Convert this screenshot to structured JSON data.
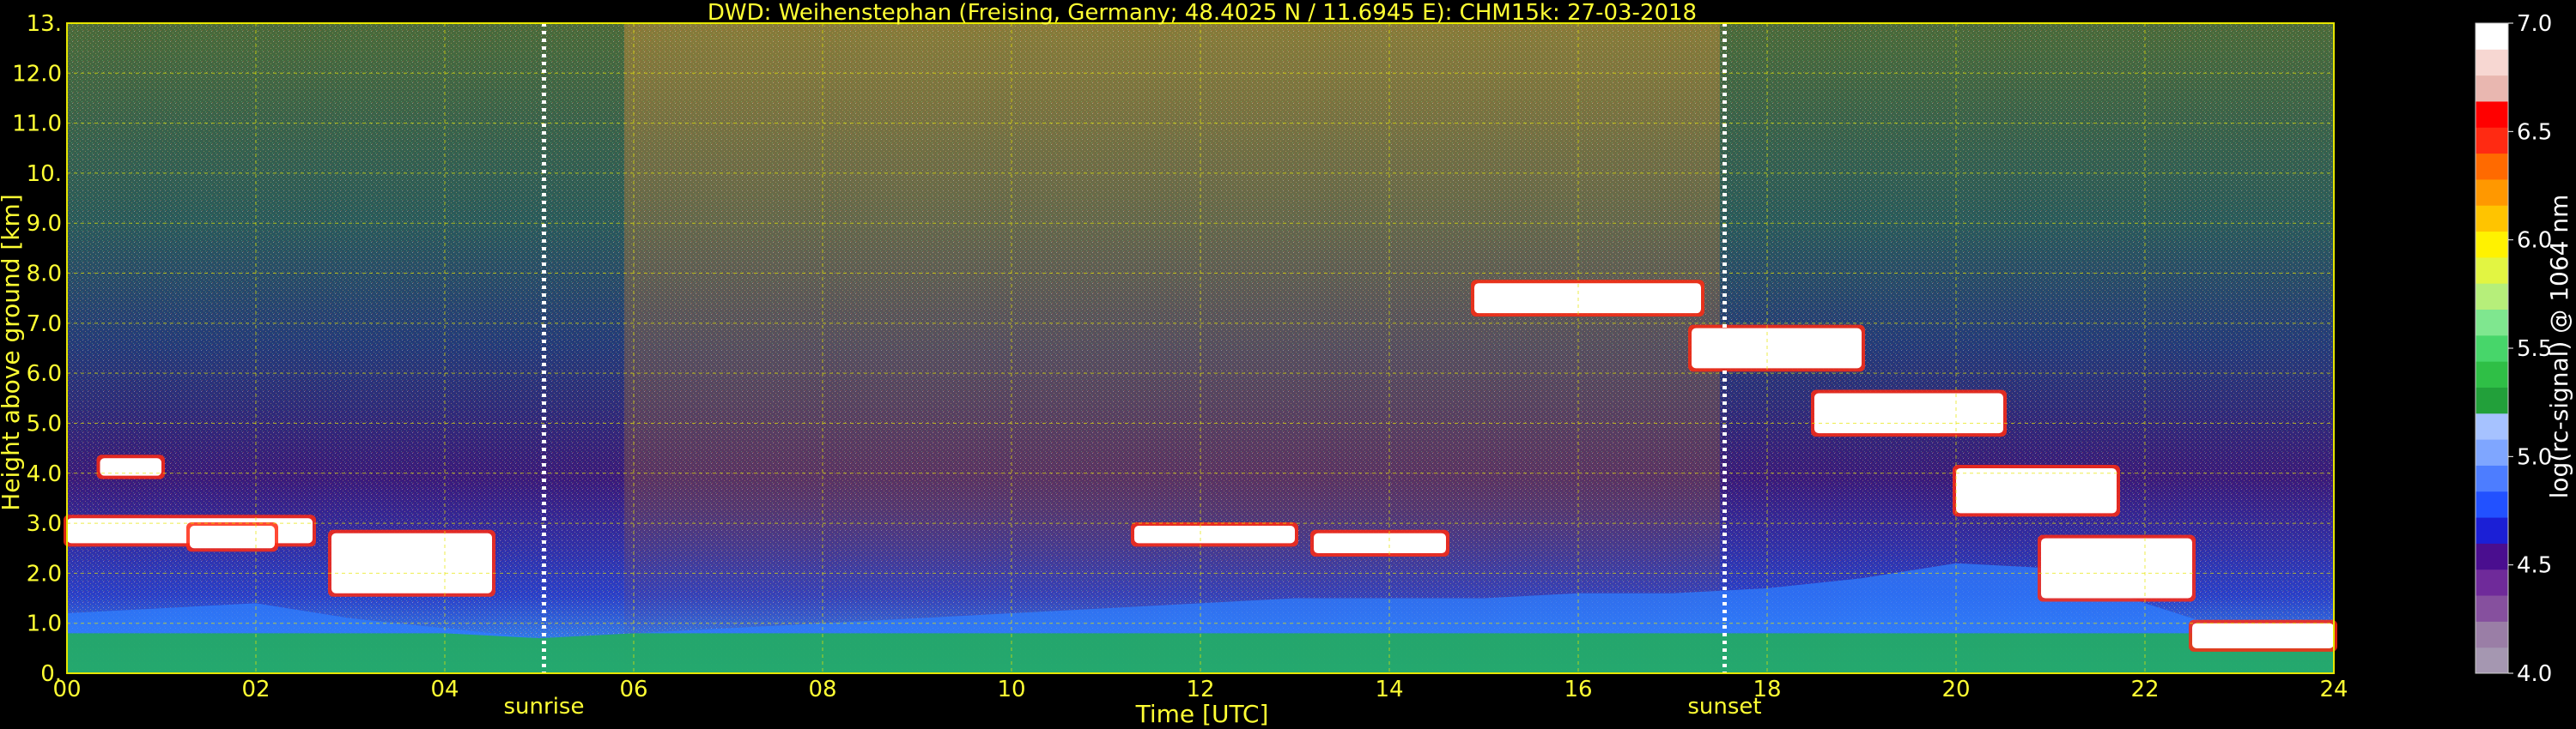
{
  "chart_data": {
    "type": "heatmap",
    "title": "DWD: Weihenstephan (Freising, Germany; 48.4025 N / 11.6945 E):    CHM15k: 27-03-2018",
    "xlabel": "Time [UTC]",
    "ylabel": "Height above ground [km]",
    "xlim": [
      0,
      24
    ],
    "ylim": [
      0,
      13
    ],
    "x_ticks": [
      "00",
      "02",
      "04",
      "06",
      "08",
      "10",
      "12",
      "14",
      "16",
      "18",
      "20",
      "22",
      "24"
    ],
    "y_ticks": [
      "0.",
      "1.0",
      "2.0",
      "3.0",
      "4.0",
      "5.0",
      "6.0",
      "7.0",
      "8.0",
      "9.0",
      "10.",
      "11.0",
      "12.0",
      "13."
    ],
    "grid": true,
    "annotations": [
      {
        "label": "sunrise",
        "x": 5.05
      },
      {
        "label": "sunset",
        "x": 17.55
      }
    ],
    "colorbar": {
      "label": "log(rc-signal) @ 1064 nm",
      "range": [
        4.0,
        7.0
      ],
      "ticks": [
        "4.0",
        "4.5",
        "5.0",
        "5.5",
        "6.0",
        "6.5",
        "7.0"
      ],
      "colors": [
        "#a597b1",
        "#9a7ea6",
        "#86509e",
        "#6f2a9a",
        "#4a0e8f",
        "#1b1fd6",
        "#2251ff",
        "#4d7dff",
        "#7fa6ff",
        "#a6c2ff",
        "#22a03a",
        "#2fbf46",
        "#47d66a",
        "#7fe78f",
        "#b6ef7a",
        "#e2f542",
        "#fff200",
        "#ffc400",
        "#ff9800",
        "#ff6a00",
        "#ff2a12",
        "#ff0000",
        "#e9b7b0",
        "#f7d7d2",
        "#ffffff"
      ]
    },
    "series": [
      {
        "name": "",
        "kind": "cloud_layers",
        "segments": [
          {
            "x0": 0.0,
            "x1": 2.6,
            "y": 2.6,
            "h": 0.5
          },
          {
            "x0": 0.35,
            "x1": 1.0,
            "y": 3.95,
            "h": 0.35
          },
          {
            "x0": 1.3,
            "x1": 2.2,
            "y": 2.5,
            "h": 0.45
          },
          {
            "x0": 2.8,
            "x1": 4.5,
            "y": 1.6,
            "h": 1.2
          },
          {
            "x0": 11.3,
            "x1": 13.0,
            "y": 2.6,
            "h": 0.35
          },
          {
            "x0": 13.2,
            "x1": 14.6,
            "y": 2.4,
            "h": 0.4
          },
          {
            "x0": 14.9,
            "x1": 17.3,
            "y": 7.2,
            "h": 0.6
          },
          {
            "x0": 17.2,
            "x1": 19.0,
            "y": 6.1,
            "h": 0.8
          },
          {
            "x0": 18.5,
            "x1": 20.5,
            "y": 4.8,
            "h": 0.8
          },
          {
            "x0": 20.0,
            "x1": 21.7,
            "y": 3.2,
            "h": 0.9
          },
          {
            "x0": 20.9,
            "x1": 22.5,
            "y": 1.5,
            "h": 1.2
          },
          {
            "x0": 22.5,
            "x1": 24.0,
            "y": 0.5,
            "h": 0.5
          }
        ]
      },
      {
        "name": "",
        "kind": "boundary_layer",
        "points": [
          [
            0,
            1.2
          ],
          [
            1,
            1.3
          ],
          [
            2,
            1.4
          ],
          [
            3,
            1.1
          ],
          [
            4,
            0.9
          ],
          [
            5,
            0.7
          ],
          [
            6,
            0.8
          ],
          [
            7,
            0.9
          ],
          [
            8,
            1.0
          ],
          [
            9,
            1.1
          ],
          [
            10,
            1.2
          ],
          [
            11,
            1.3
          ],
          [
            12,
            1.4
          ],
          [
            13,
            1.5
          ],
          [
            14,
            1.5
          ],
          [
            15,
            1.5
          ],
          [
            16,
            1.6
          ],
          [
            17,
            1.6
          ],
          [
            18,
            1.7
          ],
          [
            19,
            1.9
          ],
          [
            20,
            2.2
          ],
          [
            21,
            2.1
          ],
          [
            22,
            1.4
          ],
          [
            23,
            0.8
          ],
          [
            24,
            0.6
          ]
        ]
      }
    ]
  }
}
